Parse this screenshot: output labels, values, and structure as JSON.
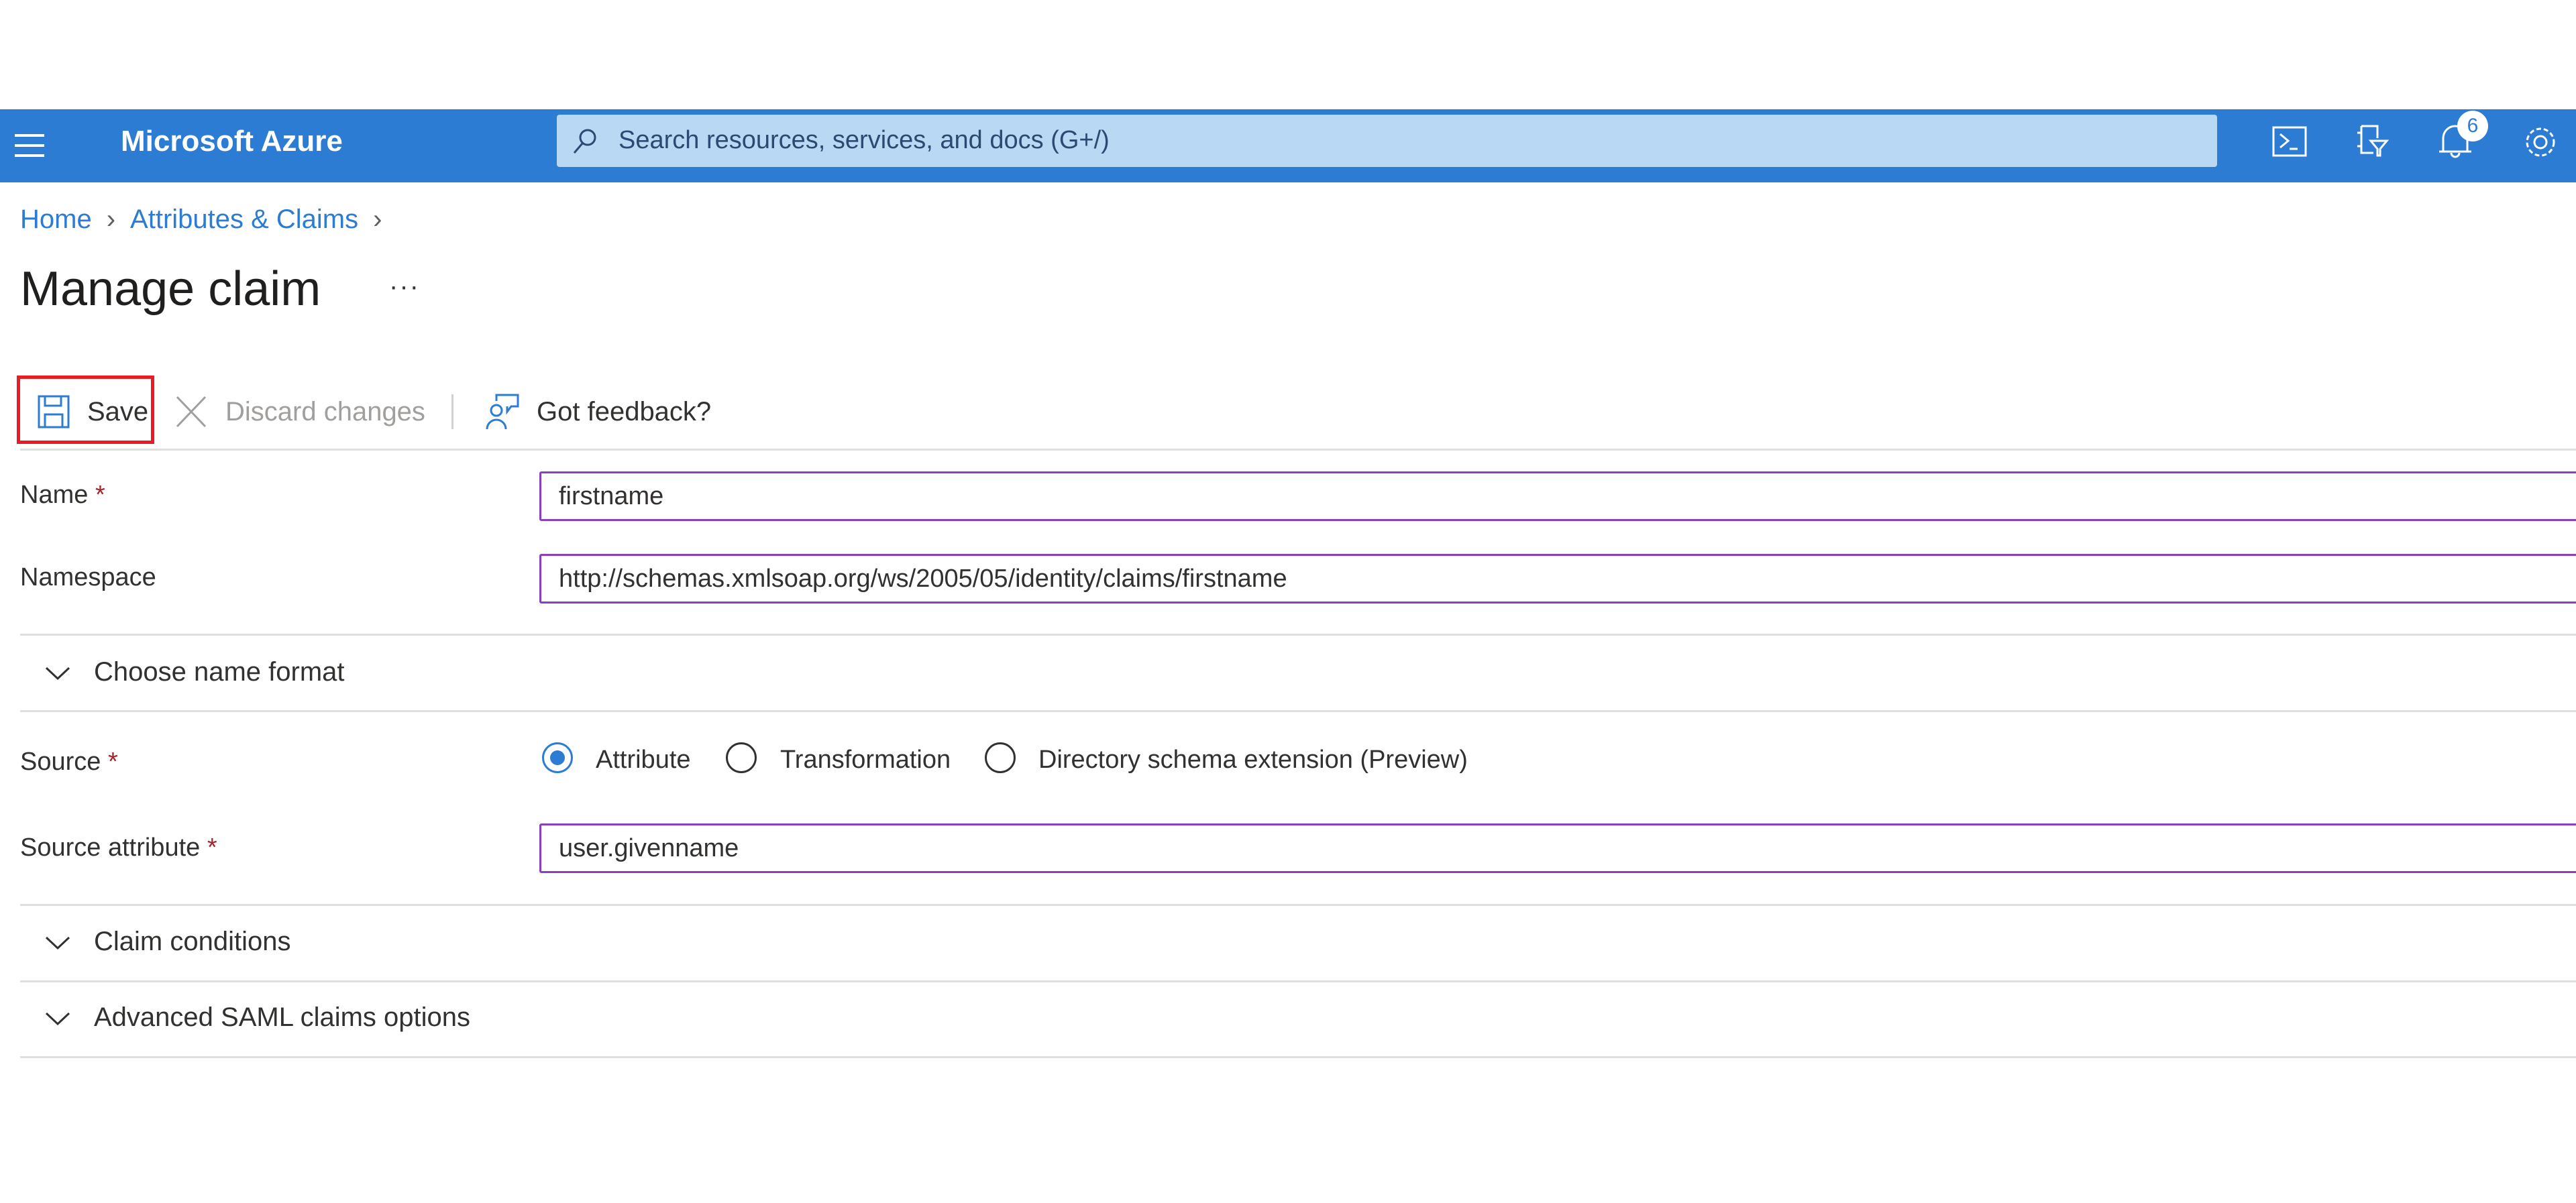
{
  "header": {
    "brand": "Microsoft Azure",
    "search_placeholder": "Search resources, services, and docs (G+/)",
    "notification_count": "6",
    "icons": [
      "hamburger-menu-icon",
      "search-icon",
      "cloud-shell-icon",
      "directory-filter-icon",
      "bell-icon",
      "gear-icon"
    ],
    "color": "#2d7cd4"
  },
  "breadcrumb": [
    "Home",
    "Attributes & Claims"
  ],
  "page": {
    "title": "Manage claim",
    "more": "···"
  },
  "toolbar": {
    "save": "Save",
    "discard": "Discard changes",
    "feedback": "Got feedback?"
  },
  "form": {
    "name_label": "Name",
    "name_value": "firstname",
    "namespace_label": "Namespace",
    "namespace_value": "http://schemas.xmlsoap.org/ws/2005/05/identity/claims/firstname",
    "choose_name_format": "Choose name format",
    "source_label": "Source",
    "source_options": [
      "Attribute",
      "Transformation",
      "Directory schema extension (Preview)"
    ],
    "source_selected": "Attribute",
    "source_attribute_label": "Source attribute",
    "source_attribute_value": "user.givenname",
    "claim_conditions": "Claim conditions",
    "advanced": "Advanced SAML claims options",
    "required_mark": "*"
  }
}
